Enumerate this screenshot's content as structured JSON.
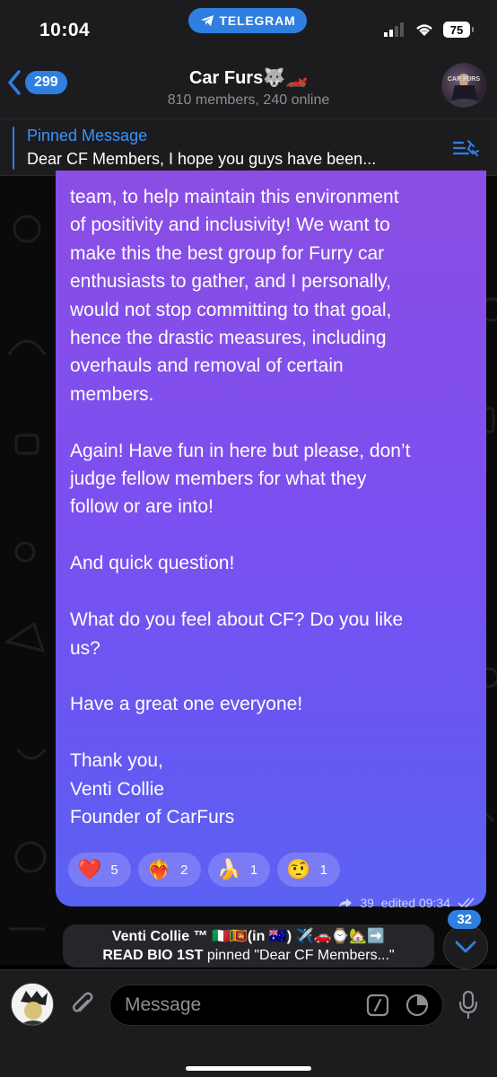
{
  "status_bar": {
    "time": "10:04",
    "banner_label": "TELEGRAM",
    "battery": "75"
  },
  "header": {
    "back_count": "299",
    "title": "Car Furs🐺🏎️",
    "subtitle": "810 members, 240 online",
    "avatar_label": "CAR FURS"
  },
  "pinned": {
    "title": "Pinned Message",
    "text": "Dear CF Members, I hope you guys have been..."
  },
  "message": {
    "text": "team, to help maintain this environment\nof positivity and inclusivity! We want to\nmake this the best group for Furry car\nenthusiasts to gather, and I personally,\nwould not stop committing to that goal,\nhence the drastic measures, including\noverhauls and removal of certain\nmembers.\n\nAgain! Have fun in here but please, don’t\njudge fellow members for what they\nfollow or are into!\n\nAnd quick question!\n\nWhat do you feel about CF? Do you like\nus?\n\nHave a great one everyone!\n\nThank you,\nVenti Collie\nFounder of CarFurs",
    "reactions": [
      {
        "emoji": "❤️",
        "count": "5"
      },
      {
        "emoji": "❤️‍🔥",
        "count": "2"
      },
      {
        "emoji": "🍌",
        "count": "1"
      },
      {
        "emoji": "🤨",
        "count": "1"
      }
    ],
    "forwards": "39",
    "edited_time": "edited 09:34"
  },
  "service_message": {
    "line1": "Venti Collie ™ 🇮🇹🇱🇰(in 🇦🇺) ✈️🚗⌚🏡➡️",
    "line2_author": "READ BIO 1ST",
    "line2_text": " pinned \"Dear CF Members...\""
  },
  "scroll": {
    "unread": "32"
  },
  "input": {
    "placeholder": "Message"
  },
  "colors": {
    "accent": "#2f7fe0",
    "bubble_top": "#8b4ee4",
    "bubble_bottom": "#5a62f3",
    "bar_bg": "#1c1c1e"
  }
}
